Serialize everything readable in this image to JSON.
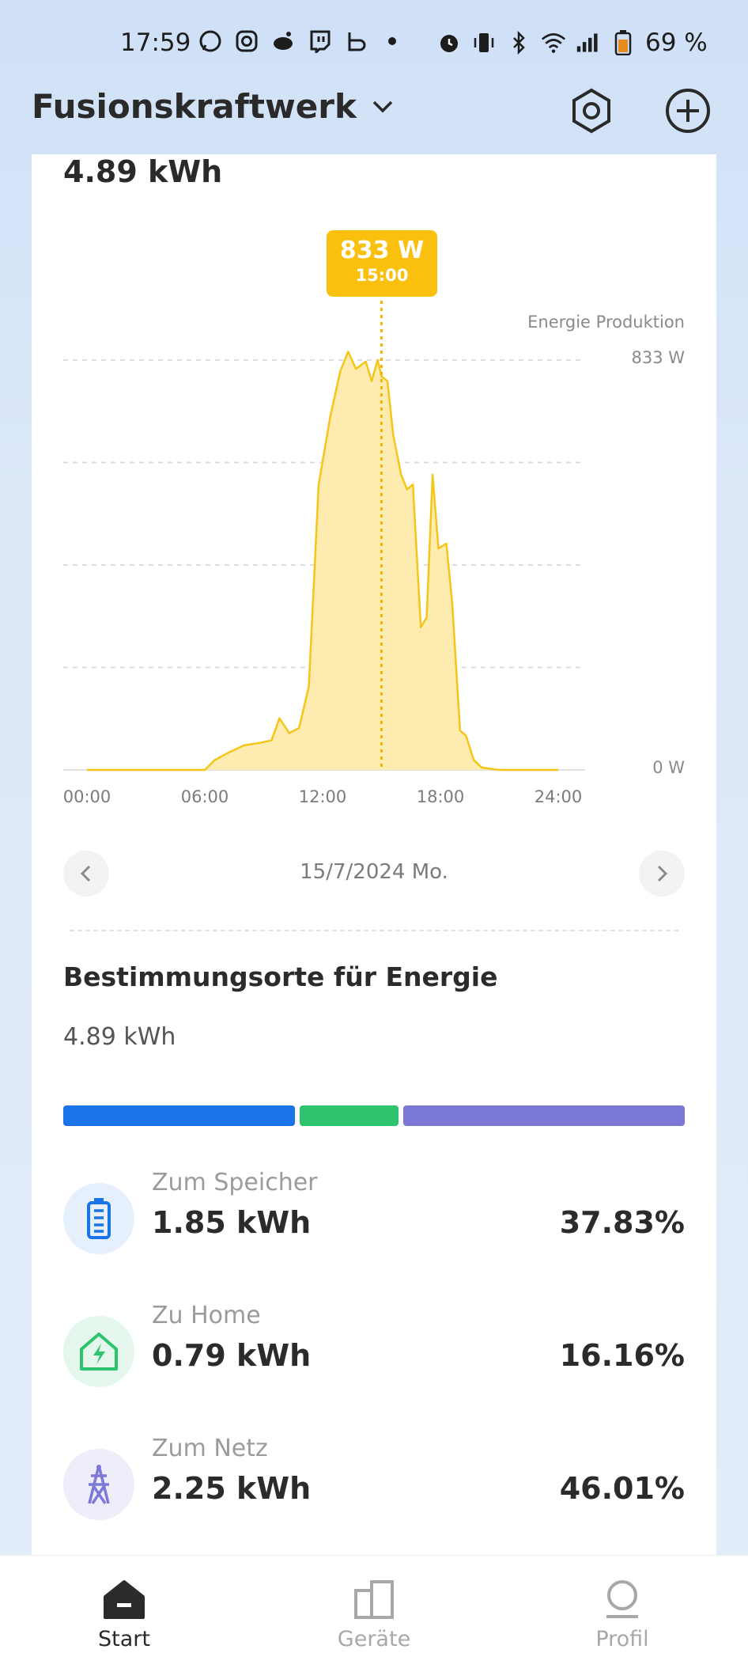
{
  "status": {
    "time": "17:59",
    "battery": "69 %"
  },
  "header": {
    "title": "Fusionskraftwerk"
  },
  "summary": {
    "energy_total": "4.89 kWh"
  },
  "tooltip": {
    "value": "833 W",
    "time": "15:00"
  },
  "chart_data": {
    "type": "area",
    "series_label": "Energie Produktion",
    "y_labels": [
      "833 W",
      "0 W"
    ],
    "x_ticks": [
      "00:00",
      "06:00",
      "12:00",
      "18:00",
      "24:00"
    ],
    "ylim": [
      0,
      833
    ],
    "xlim": [
      0,
      24
    ],
    "color": "#f5c518",
    "selected_x": 15,
    "x": [
      0,
      6.0,
      6.5,
      7.2,
      8.0,
      8.8,
      9.4,
      9.8,
      10.3,
      10.8,
      11.3,
      11.8,
      12.4,
      12.9,
      13.3,
      13.7,
      14.2,
      14.5,
      14.8,
      15.0,
      15.3,
      15.6,
      16.0,
      16.3,
      16.6,
      17.0,
      17.3,
      17.6,
      17.9,
      18.3,
      18.6,
      19.0,
      19.3,
      19.7,
      20.1,
      20.6,
      21.0,
      21.5,
      22.0,
      24.0
    ],
    "y": [
      0,
      0,
      20,
      35,
      50,
      55,
      60,
      105,
      75,
      85,
      170,
      580,
      720,
      810,
      850,
      815,
      830,
      790,
      833,
      800,
      790,
      680,
      600,
      570,
      580,
      290,
      310,
      600,
      450,
      460,
      340,
      80,
      70,
      20,
      5,
      2,
      0,
      0,
      0,
      0
    ]
  },
  "date_nav": {
    "date": "15/7/2024 Mo."
  },
  "destinations": {
    "title": "Bestimmungsorte für Energie",
    "total": "4.89 kWh",
    "items": [
      {
        "label": "Zum Speicher",
        "value": "1.85 kWh",
        "percent": "37.83%",
        "share": 37.83,
        "color": "#1a73e8",
        "icon": "battery-icon"
      },
      {
        "label": "Zu Home",
        "value": "0.79 kWh",
        "percent": "16.16%",
        "share": 16.16,
        "color": "#2ec46e",
        "icon": "home-energy-icon"
      },
      {
        "label": "Zum Netz",
        "value": "2.25 kWh",
        "percent": "46.01%",
        "share": 46.01,
        "color": "#7c78d8",
        "icon": "grid-tower-icon"
      }
    ]
  },
  "tabs": [
    {
      "label": "Start",
      "active": true
    },
    {
      "label": "Geräte",
      "active": false
    },
    {
      "label": "Profil",
      "active": false
    }
  ]
}
